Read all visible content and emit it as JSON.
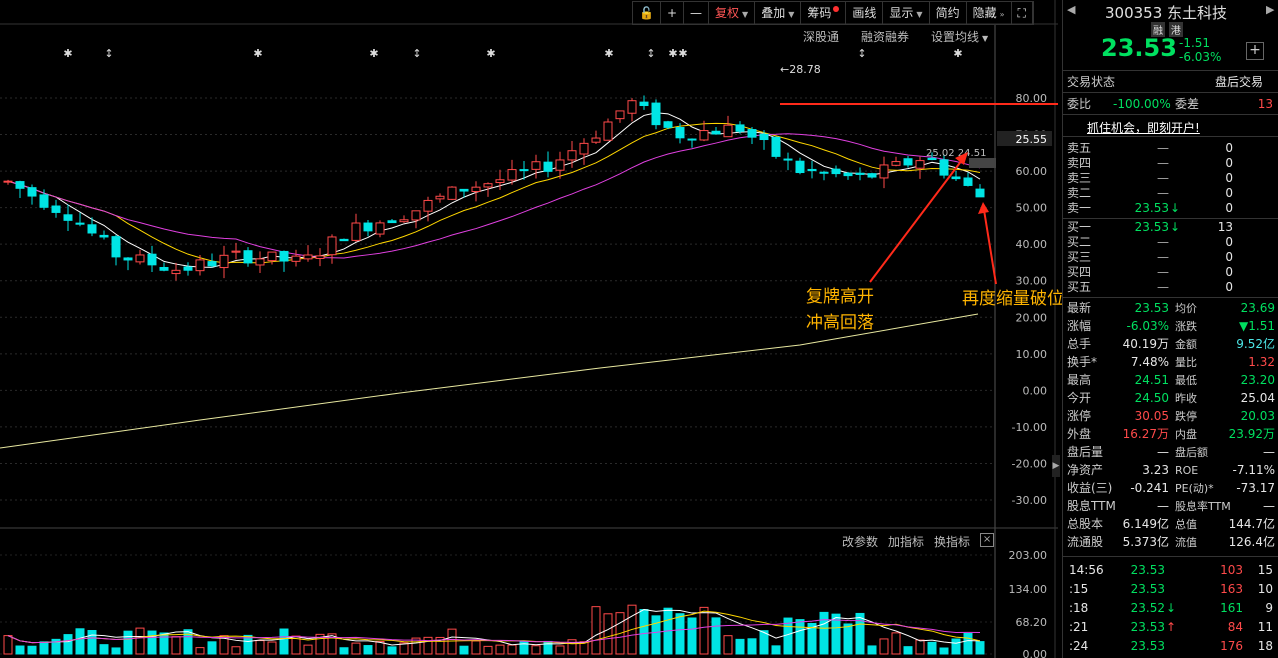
{
  "toolbar": {
    "items": [
      "复权",
      "叠加",
      "筹码",
      "画线",
      "显示",
      "简约",
      "隐藏"
    ]
  },
  "submenu": {
    "items": [
      "深股通",
      "融资融券",
      "设置均线"
    ]
  },
  "axis": {
    "main_ticks": [
      "80.00",
      "70.00",
      "60.00",
      "50.00",
      "40.00",
      "30.00",
      "20.00",
      "10.00",
      "0.00",
      "-10.00",
      "-20.00",
      "-30.00"
    ],
    "current_price_tag": "25.55",
    "vol_ticks": [
      "203.00",
      "134.00",
      "68.20",
      "0.00"
    ]
  },
  "chart_labels": {
    "high": "28.78",
    "price_label_a": "25.02",
    "price_label_b": "24.51"
  },
  "annotations": {
    "a_line1": "复牌高开",
    "a_line2": "冲高回落",
    "b_line1": "再度缩量破位洗"
  },
  "indicator_bar": {
    "items": [
      "改参数",
      "加指标",
      "换指标"
    ],
    "close": "×"
  },
  "stock": {
    "code": "300353",
    "name": "东土科技",
    "tag1": "融",
    "tag2": "港",
    "price": "23.53",
    "change": "-1.51",
    "pct": "-6.03%",
    "plus": "+"
  },
  "status": {
    "label": "交易状态",
    "value": "盘后交易"
  },
  "ratio": {
    "label1": "委比",
    "value1": "-100.00%",
    "label2": "委差",
    "value2": "13"
  },
  "promo": "抓住机会，即刻开户!",
  "sells": [
    {
      "label": "卖五",
      "price": "—",
      "vol": "0"
    },
    {
      "label": "卖四",
      "price": "—",
      "vol": "0"
    },
    {
      "label": "卖三",
      "price": "—",
      "vol": "0"
    },
    {
      "label": "卖二",
      "price": "—",
      "vol": "0"
    },
    {
      "label": "卖一",
      "price": "23.53",
      "vol": "0",
      "arrow": "↓"
    }
  ],
  "buys": [
    {
      "label": "买一",
      "price": "23.53",
      "vol": "13",
      "arrow": "↓"
    },
    {
      "label": "买二",
      "price": "—",
      "vol": "0"
    },
    {
      "label": "买三",
      "price": "—",
      "vol": "0"
    },
    {
      "label": "买四",
      "price": "—",
      "vol": "0"
    },
    {
      "label": "买五",
      "price": "—",
      "vol": "0"
    }
  ],
  "stats": [
    {
      "l1": "最新",
      "v1": "23.53",
      "c1": "green",
      "l2": "均价",
      "v2": "23.69",
      "c2": "green"
    },
    {
      "l1": "涨幅",
      "v1": "-6.03%",
      "c1": "green",
      "l2": "涨跌",
      "v2": "▼1.51",
      "c2": "green"
    },
    {
      "l1": "总手",
      "v1": "40.19万",
      "c1": "white",
      "l2": "金额",
      "v2": "9.52亿",
      "c2": "cyan"
    },
    {
      "l1": "换手*",
      "v1": "7.48%",
      "c1": "white",
      "l2": "量比",
      "v2": "1.32",
      "c2": "red"
    },
    {
      "l1": "最高",
      "v1": "24.51",
      "c1": "green",
      "l2": "最低",
      "v2": "23.20",
      "c2": "green"
    },
    {
      "l1": "今开",
      "v1": "24.50",
      "c1": "green",
      "l2": "昨收",
      "v2": "25.04",
      "c2": "white"
    },
    {
      "l1": "涨停",
      "v1": "30.05",
      "c1": "red",
      "l2": "跌停",
      "v2": "20.03",
      "c2": "green"
    },
    {
      "l1": "外盘",
      "v1": "16.27万",
      "c1": "red",
      "l2": "内盘",
      "v2": "23.92万",
      "c2": "green"
    },
    {
      "l1": "盘后量",
      "v1": "—",
      "c1": "white",
      "l2": "盘后额",
      "v2": "—",
      "c2": "white"
    },
    {
      "l1": "净资产",
      "v1": "3.23",
      "c1": "white",
      "l2": "ROE",
      "v2": "-7.11%",
      "c2": "white"
    },
    {
      "l1": "收益(三)",
      "v1": "-0.241",
      "c1": "white",
      "l2": "PE(动)*",
      "v2": "-73.17",
      "c2": "white"
    },
    {
      "l1": "股息TTM",
      "v1": "—",
      "c1": "white",
      "l2": "股息率TTM",
      "v2": "—",
      "c2": "white"
    },
    {
      "l1": "总股本",
      "v1": "6.149亿",
      "c1": "white",
      "l2": "总值",
      "v2": "144.7亿",
      "c2": "white"
    },
    {
      "l1": "流通股",
      "v1": "5.373亿",
      "c1": "white",
      "l2": "流值",
      "v2": "126.4亿",
      "c2": "white"
    }
  ],
  "ticks": [
    {
      "time": "14:56",
      "price": "23.53",
      "vol": "103",
      "n": "15",
      "arrow": ""
    },
    {
      "time": ":15",
      "price": "23.53",
      "vol": "163",
      "n": "10",
      "arrow": ""
    },
    {
      "time": ":18",
      "price": "23.52",
      "vol": "161",
      "n": "9",
      "arrow": "↓"
    },
    {
      "time": ":21",
      "price": "23.53",
      "vol": "84",
      "n": "11",
      "arrow": "↑"
    },
    {
      "time": ":24",
      "price": "23.53",
      "vol": "176",
      "n": "18",
      "arrow": ""
    }
  ],
  "colors": {
    "up": "#ff4a4a",
    "down": "#00e5e5",
    "ma5": "#ffffff",
    "ma10": "#ffd700",
    "ma20": "#e040e0",
    "longma": "#e8e8a0",
    "arrow": "#ff2a1a"
  }
}
